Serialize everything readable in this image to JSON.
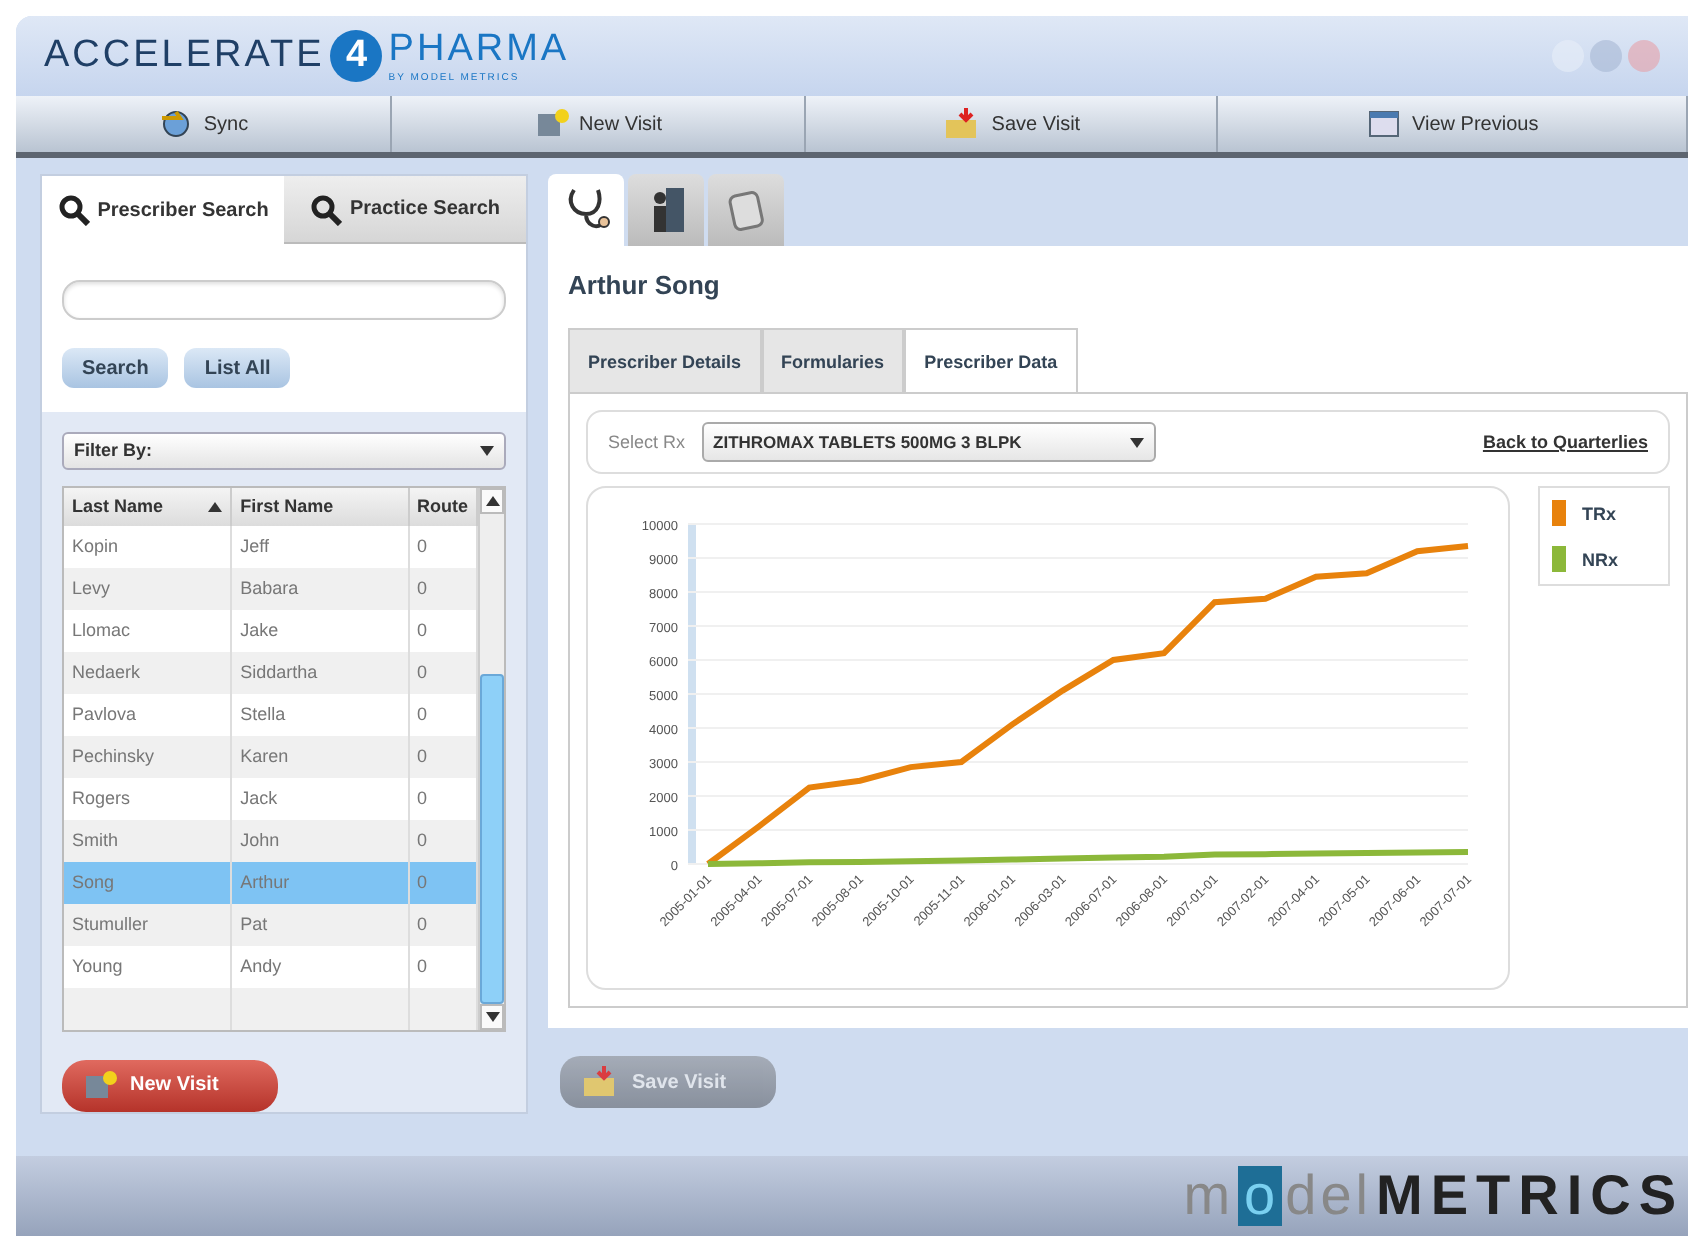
{
  "header": {
    "logo": {
      "word1": "ACCELERATE",
      "digit": "4",
      "word2": "PHARMA",
      "byline": "BY MODEL METRICS"
    }
  },
  "toolbar": [
    {
      "label": "Sync",
      "kind": "sync"
    },
    {
      "label": "New Visit",
      "kind": "new"
    },
    {
      "label": "Save Visit",
      "kind": "save"
    },
    {
      "label": "View Previous",
      "kind": "view"
    }
  ],
  "search_tabs": [
    {
      "label": "Prescriber Search",
      "selected": true
    },
    {
      "label": "Practice Search",
      "selected": false
    }
  ],
  "search_buttons": [
    "Search",
    "List All"
  ],
  "filter": {
    "label": "Filter By:"
  },
  "table": {
    "columns": [
      {
        "label": "Last Name",
        "sorted": true
      },
      {
        "label": "First Name",
        "sorted": false
      },
      {
        "label": "Route",
        "sorted": false
      }
    ],
    "rows": [
      {
        "cells": [
          "Kopin",
          "Jeff",
          "0"
        ],
        "selected": false
      },
      {
        "cells": [
          "Levy",
          "Babara",
          "0"
        ],
        "selected": false
      },
      {
        "cells": [
          "Llomac",
          "Jake",
          "0"
        ],
        "selected": false
      },
      {
        "cells": [
          "Nedaerk",
          "Siddartha",
          "0"
        ],
        "selected": false
      },
      {
        "cells": [
          "Pavlova",
          "Stella",
          "0"
        ],
        "selected": false
      },
      {
        "cells": [
          "Pechinsky",
          "Karen",
          "0"
        ],
        "selected": false
      },
      {
        "cells": [
          "Rogers",
          "Jack",
          "0"
        ],
        "selected": false
      },
      {
        "cells": [
          "Smith",
          "John",
          "0"
        ],
        "selected": false
      },
      {
        "cells": [
          "Song",
          "Arthur",
          "0"
        ],
        "selected": true
      },
      {
        "cells": [
          "Stumuller",
          "Pat",
          "0"
        ],
        "selected": false
      },
      {
        "cells": [
          "Young",
          "Andy",
          "0"
        ],
        "selected": false
      }
    ]
  },
  "new_visit_button": "New Visit",
  "detail_tabs": [
    {
      "kind": "stethoscope",
      "selected": true
    },
    {
      "kind": "person",
      "selected": false
    },
    {
      "kind": "document",
      "selected": false
    }
  ],
  "prescriber_name": "Arthur Song",
  "info_tabs": [
    {
      "label": "Prescriber Details",
      "selected": false
    },
    {
      "label": "Formularies",
      "selected": false
    },
    {
      "label": "Prescriber Data",
      "selected": true
    }
  ],
  "rx": {
    "label": "Select Rx",
    "value": "ZITHROMAX TABLETS 500MG 3 BLPK",
    "link": "Back to Quarterlies"
  },
  "chart_data": {
    "type": "line",
    "categories": [
      "2005-01-01",
      "2005-04-01",
      "2005-07-01",
      "2005-08-01",
      "2005-10-01",
      "2005-11-01",
      "2006-01-01",
      "2006-03-01",
      "2006-07-01",
      "2006-08-01",
      "2007-01-01",
      "2007-02-01",
      "2007-04-01",
      "2007-05-01",
      "2007-06-01",
      "2007-07-01"
    ],
    "grid": true,
    "ylim": [
      0,
      10000
    ],
    "yticks": [
      0,
      1000,
      2000,
      3000,
      4000,
      5000,
      6000,
      7000,
      8000,
      9000,
      10000
    ],
    "series": [
      {
        "name": "TRx",
        "color": "#e8820c",
        "values": [
          0,
          1100,
          2250,
          2450,
          2850,
          3000,
          4100,
          5100,
          6000,
          6200,
          7700,
          7800,
          8450,
          8550,
          9200,
          9350
        ]
      },
      {
        "name": "NRx",
        "color": "#8cb83a",
        "values": [
          0,
          20,
          50,
          60,
          80,
          100,
          130,
          160,
          190,
          210,
          280,
          290,
          310,
          320,
          340,
          350
        ]
      }
    ]
  },
  "save_visit_button": {
    "label": "Save Visit",
    "disabled": true
  },
  "footer": {
    "brand": [
      "m",
      "o",
      "del",
      "METRICS"
    ]
  }
}
